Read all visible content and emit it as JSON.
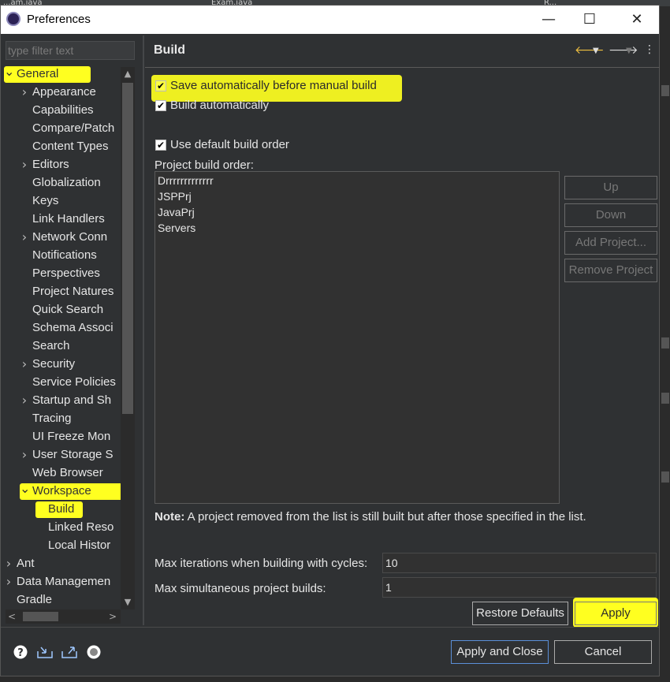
{
  "background": {
    "tabs": [
      "...am.java",
      "Exam.java",
      "R..."
    ]
  },
  "window": {
    "title": "Preferences",
    "minimize_label": "—",
    "maximize_label": "☐",
    "close_label": "✕"
  },
  "sidebar": {
    "filter_placeholder": "type filter text",
    "items": [
      {
        "label": "General",
        "level": 0,
        "expanded": true,
        "highlight": true
      },
      {
        "label": "Appearance",
        "level": 1,
        "has_children": true
      },
      {
        "label": "Capabilities",
        "level": 1
      },
      {
        "label": "Compare/Patch",
        "level": 1
      },
      {
        "label": "Content Types",
        "level": 1
      },
      {
        "label": "Editors",
        "level": 1,
        "has_children": true
      },
      {
        "label": "Globalization",
        "level": 1
      },
      {
        "label": "Keys",
        "level": 1
      },
      {
        "label": "Link Handlers",
        "level": 1
      },
      {
        "label": "Network Conn",
        "level": 1,
        "has_children": true
      },
      {
        "label": "Notifications",
        "level": 1
      },
      {
        "label": "Perspectives",
        "level": 1
      },
      {
        "label": "Project Natures",
        "level": 1
      },
      {
        "label": "Quick Search",
        "level": 1
      },
      {
        "label": "Schema Associ",
        "level": 1
      },
      {
        "label": "Search",
        "level": 1
      },
      {
        "label": "Security",
        "level": 1,
        "has_children": true
      },
      {
        "label": "Service Policies",
        "level": 1
      },
      {
        "label": "Startup and Sh",
        "level": 1,
        "has_children": true
      },
      {
        "label": "Tracing",
        "level": 1
      },
      {
        "label": "UI Freeze Mon",
        "level": 1
      },
      {
        "label": "User Storage S",
        "level": 1,
        "has_children": true
      },
      {
        "label": "Web Browser",
        "level": 1
      },
      {
        "label": "Workspace",
        "level": 1,
        "expanded": true,
        "highlight": true
      },
      {
        "label": "Build",
        "level": 2,
        "selected": true,
        "highlight": true
      },
      {
        "label": "Linked Reso",
        "level": 2
      },
      {
        "label": "Local Histor",
        "level": 2
      },
      {
        "label": "Ant",
        "level": 0,
        "has_children": true
      },
      {
        "label": "Data Managemen",
        "level": 0,
        "has_children": true
      },
      {
        "label": "Gradle",
        "level": 0
      }
    ]
  },
  "page": {
    "heading": "Build",
    "save_auto_label": "Save automatically before manual build",
    "save_auto_checked": true,
    "build_auto_label": "Build automatically",
    "build_auto_checked": true,
    "default_order_label": "Use default build order",
    "default_order_checked": true,
    "order_label": "Project build order:",
    "projects": [
      "Drrrrrrrrrrrrr",
      "JSPPrj",
      "JavaPrj",
      "Servers"
    ],
    "buttons": {
      "up": "Up",
      "down": "Down",
      "add_project": "Add Project...",
      "remove_project": "Remove Project"
    },
    "note_bold": "Note:",
    "note_text": " A project removed from the list is still built but after those specified in the list.",
    "max_iter_label": "Max iterations when building with cycles:",
    "max_iter_value": "10",
    "max_sim_label": "Max simultaneous project builds:",
    "max_sim_value": "1",
    "restore_defaults": "Restore Defaults",
    "apply": "Apply"
  },
  "footer": {
    "apply_close": "Apply and Close",
    "cancel": "Cancel",
    "icons": [
      "help-icon",
      "import-icon",
      "export-icon",
      "oomph-icon"
    ]
  },
  "colors": {
    "highlight": "#ffff20",
    "background": "#2f3133"
  }
}
